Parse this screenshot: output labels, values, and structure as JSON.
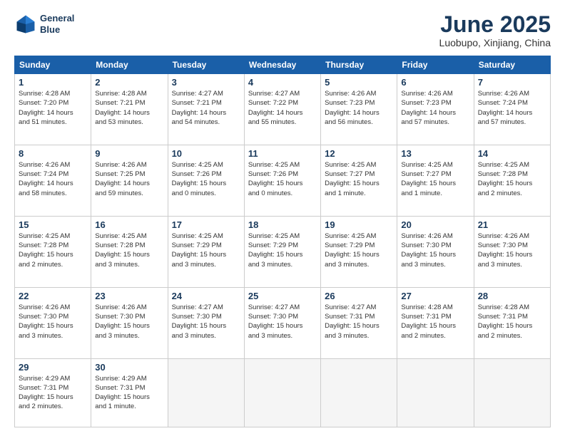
{
  "header": {
    "logo_line1": "General",
    "logo_line2": "Blue",
    "month": "June 2025",
    "location": "Luobupo, Xinjiang, China"
  },
  "days_of_week": [
    "Sunday",
    "Monday",
    "Tuesday",
    "Wednesday",
    "Thursday",
    "Friday",
    "Saturday"
  ],
  "weeks": [
    [
      {
        "day": 1,
        "info": "Sunrise: 4:28 AM\nSunset: 7:20 PM\nDaylight: 14 hours\nand 51 minutes."
      },
      {
        "day": 2,
        "info": "Sunrise: 4:28 AM\nSunset: 7:21 PM\nDaylight: 14 hours\nand 53 minutes."
      },
      {
        "day": 3,
        "info": "Sunrise: 4:27 AM\nSunset: 7:21 PM\nDaylight: 14 hours\nand 54 minutes."
      },
      {
        "day": 4,
        "info": "Sunrise: 4:27 AM\nSunset: 7:22 PM\nDaylight: 14 hours\nand 55 minutes."
      },
      {
        "day": 5,
        "info": "Sunrise: 4:26 AM\nSunset: 7:23 PM\nDaylight: 14 hours\nand 56 minutes."
      },
      {
        "day": 6,
        "info": "Sunrise: 4:26 AM\nSunset: 7:23 PM\nDaylight: 14 hours\nand 57 minutes."
      },
      {
        "day": 7,
        "info": "Sunrise: 4:26 AM\nSunset: 7:24 PM\nDaylight: 14 hours\nand 57 minutes."
      }
    ],
    [
      {
        "day": 8,
        "info": "Sunrise: 4:26 AM\nSunset: 7:24 PM\nDaylight: 14 hours\nand 58 minutes."
      },
      {
        "day": 9,
        "info": "Sunrise: 4:26 AM\nSunset: 7:25 PM\nDaylight: 14 hours\nand 59 minutes."
      },
      {
        "day": 10,
        "info": "Sunrise: 4:25 AM\nSunset: 7:26 PM\nDaylight: 15 hours\nand 0 minutes."
      },
      {
        "day": 11,
        "info": "Sunrise: 4:25 AM\nSunset: 7:26 PM\nDaylight: 15 hours\nand 0 minutes."
      },
      {
        "day": 12,
        "info": "Sunrise: 4:25 AM\nSunset: 7:27 PM\nDaylight: 15 hours\nand 1 minute."
      },
      {
        "day": 13,
        "info": "Sunrise: 4:25 AM\nSunset: 7:27 PM\nDaylight: 15 hours\nand 1 minute."
      },
      {
        "day": 14,
        "info": "Sunrise: 4:25 AM\nSunset: 7:28 PM\nDaylight: 15 hours\nand 2 minutes."
      }
    ],
    [
      {
        "day": 15,
        "info": "Sunrise: 4:25 AM\nSunset: 7:28 PM\nDaylight: 15 hours\nand 2 minutes."
      },
      {
        "day": 16,
        "info": "Sunrise: 4:25 AM\nSunset: 7:28 PM\nDaylight: 15 hours\nand 3 minutes."
      },
      {
        "day": 17,
        "info": "Sunrise: 4:25 AM\nSunset: 7:29 PM\nDaylight: 15 hours\nand 3 minutes."
      },
      {
        "day": 18,
        "info": "Sunrise: 4:25 AM\nSunset: 7:29 PM\nDaylight: 15 hours\nand 3 minutes."
      },
      {
        "day": 19,
        "info": "Sunrise: 4:25 AM\nSunset: 7:29 PM\nDaylight: 15 hours\nand 3 minutes."
      },
      {
        "day": 20,
        "info": "Sunrise: 4:26 AM\nSunset: 7:30 PM\nDaylight: 15 hours\nand 3 minutes."
      },
      {
        "day": 21,
        "info": "Sunrise: 4:26 AM\nSunset: 7:30 PM\nDaylight: 15 hours\nand 3 minutes."
      }
    ],
    [
      {
        "day": 22,
        "info": "Sunrise: 4:26 AM\nSunset: 7:30 PM\nDaylight: 15 hours\nand 3 minutes."
      },
      {
        "day": 23,
        "info": "Sunrise: 4:26 AM\nSunset: 7:30 PM\nDaylight: 15 hours\nand 3 minutes."
      },
      {
        "day": 24,
        "info": "Sunrise: 4:27 AM\nSunset: 7:30 PM\nDaylight: 15 hours\nand 3 minutes."
      },
      {
        "day": 25,
        "info": "Sunrise: 4:27 AM\nSunset: 7:30 PM\nDaylight: 15 hours\nand 3 minutes."
      },
      {
        "day": 26,
        "info": "Sunrise: 4:27 AM\nSunset: 7:31 PM\nDaylight: 15 hours\nand 3 minutes."
      },
      {
        "day": 27,
        "info": "Sunrise: 4:28 AM\nSunset: 7:31 PM\nDaylight: 15 hours\nand 2 minutes."
      },
      {
        "day": 28,
        "info": "Sunrise: 4:28 AM\nSunset: 7:31 PM\nDaylight: 15 hours\nand 2 minutes."
      }
    ],
    [
      {
        "day": 29,
        "info": "Sunrise: 4:29 AM\nSunset: 7:31 PM\nDaylight: 15 hours\nand 2 minutes."
      },
      {
        "day": 30,
        "info": "Sunrise: 4:29 AM\nSunset: 7:31 PM\nDaylight: 15 hours\nand 1 minute."
      },
      null,
      null,
      null,
      null,
      null
    ]
  ]
}
